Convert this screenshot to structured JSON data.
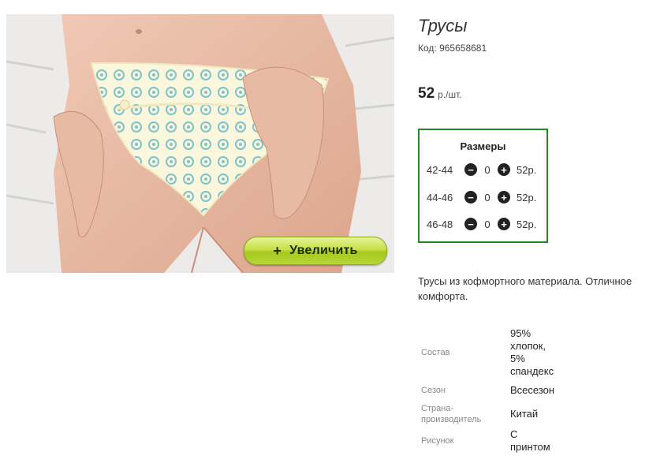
{
  "product": {
    "title": "Трусы",
    "code": "Код: 965658681",
    "price_value": "52",
    "price_unit": "р./шт."
  },
  "zoom_button": {
    "icon": "plus-icon",
    "label": "Увеличить"
  },
  "sizes": {
    "title": "Размеры",
    "rows": [
      {
        "range": "42-44",
        "qty": "0",
        "price": "52р."
      },
      {
        "range": "44-46",
        "qty": "0",
        "price": "52р."
      },
      {
        "range": "46-48",
        "qty": "0",
        "price": "52р."
      }
    ],
    "minus_icon": "minus-circle-icon",
    "plus_icon": "plus-circle-icon"
  },
  "description": {
    "line1": "Трусы из кофмортного материала. Отличное",
    "line2": "комфорта."
  },
  "specs": [
    {
      "label": "Состав",
      "value": [
        "95%",
        "хлопок,",
        "5%",
        "спандекс"
      ]
    },
    {
      "label": "Сезон",
      "value": [
        "Всесезон"
      ]
    },
    {
      "label_lines": [
        "Страна-",
        "производитель"
      ],
      "value": [
        "Китай"
      ]
    },
    {
      "label": "Рисунок",
      "value": [
        "С",
        "принтом"
      ]
    }
  ],
  "colors": {
    "accent_border": "#1f8a1f",
    "zoom_button": "#b7d638"
  }
}
